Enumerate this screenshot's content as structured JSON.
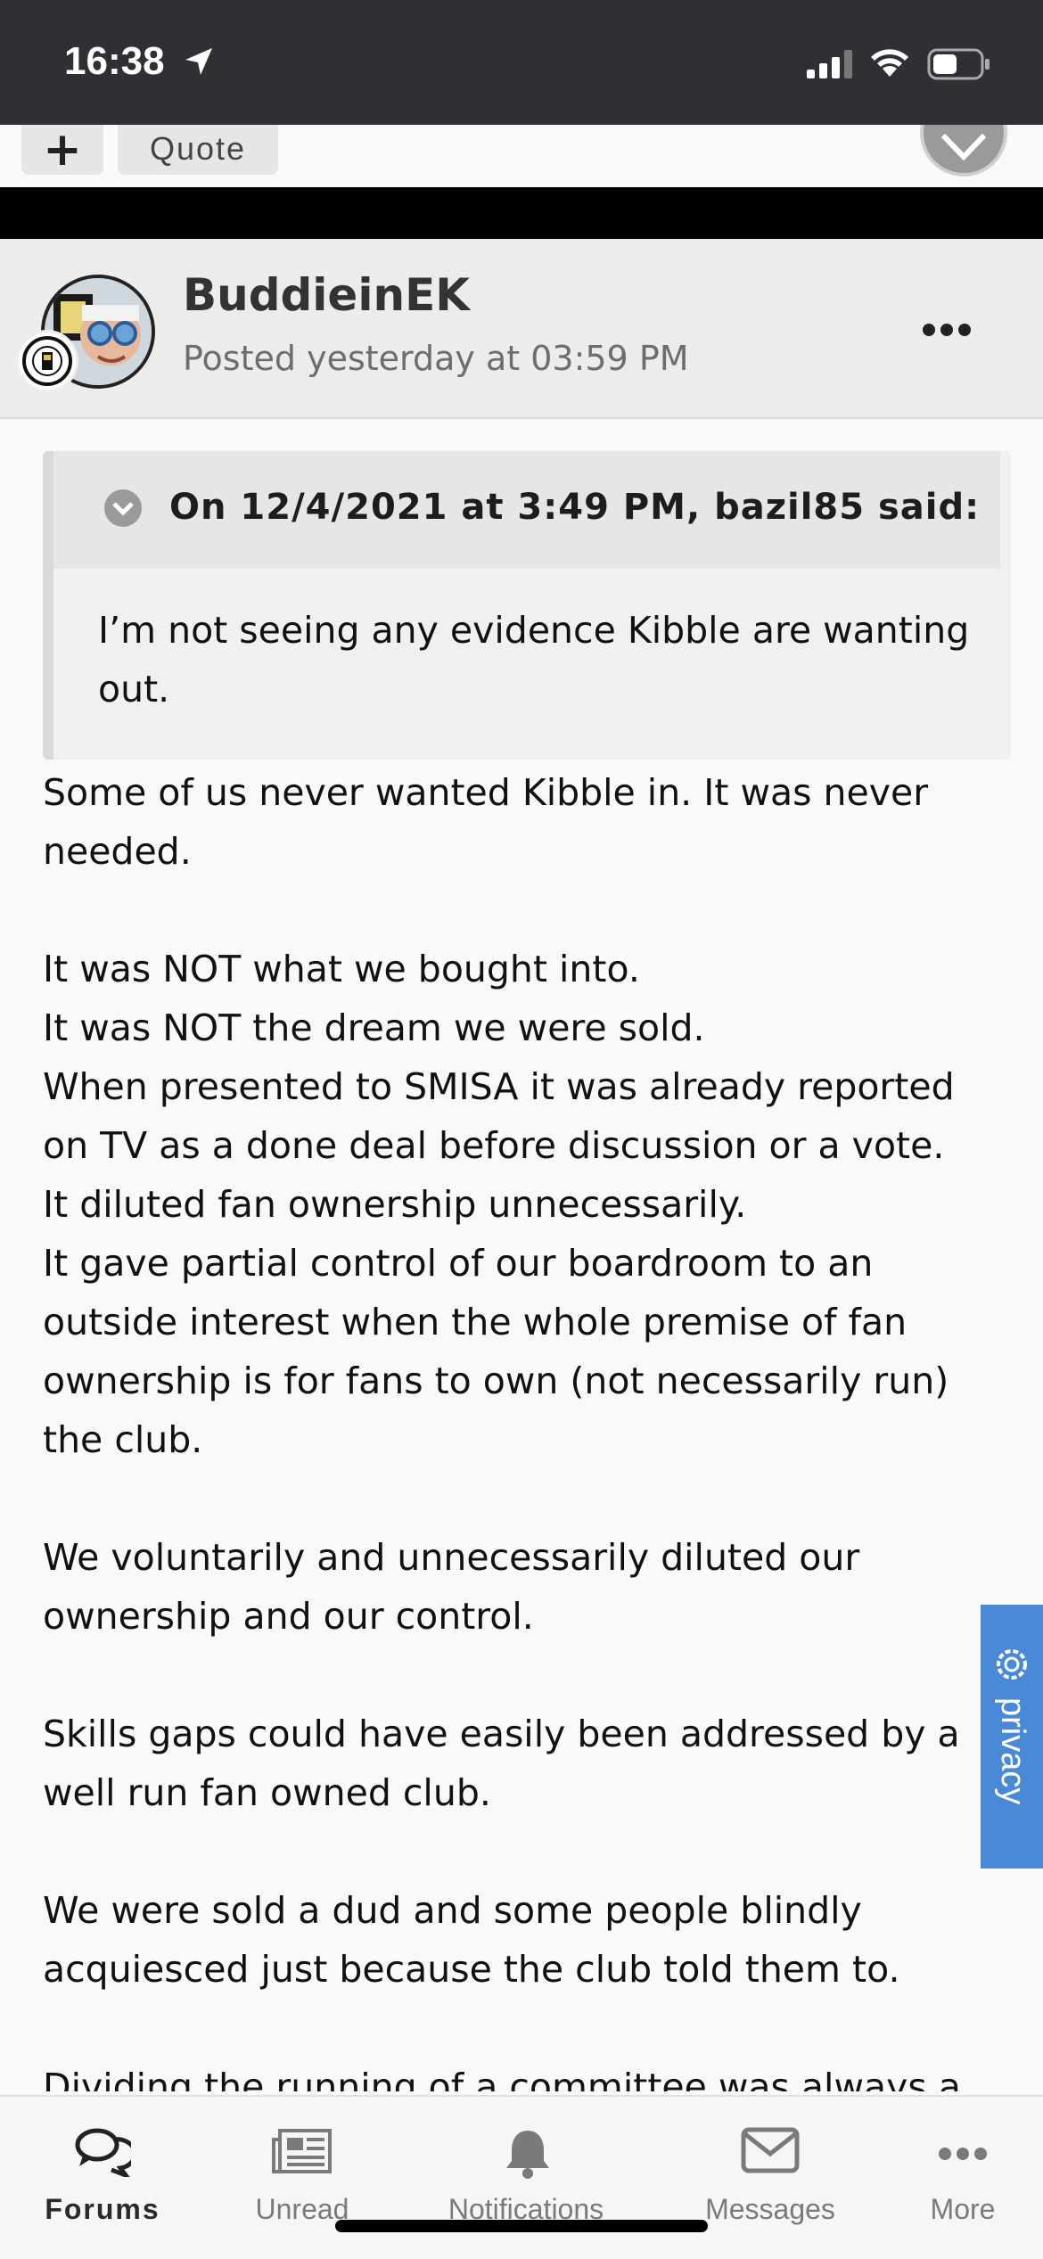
{
  "status_bar": {
    "time": "16:38"
  },
  "previous_post": {
    "plus_label": "+",
    "quote_label": "Quote"
  },
  "post": {
    "author": "BuddieinEK",
    "posted": "Posted yesterday at 03:59 PM",
    "quote": {
      "cite": "On 12/4/2021 at 3:49 PM, bazil85 said:",
      "text": "I’m not seeing any evidence Kibble are wanting out."
    },
    "paragraphs": [
      "Some of us never wanted Kibble in. It was never needed.",
      "It was NOT what we bought into.\nIt was NOT the dream we were sold.\nWhen presented to SMISA it was already reported on TV as a done deal before discussion or a vote.\nIt diluted fan ownership unnecessarily.\nIt gave partial control of our boardroom to an outside interest when the whole premise of fan ownership is for fans to own (not necessarily run) the club.",
      "We voluntarily and unnecessarily diluted our ownership and our control.",
      "Skills gaps could have easily been addressed by a well run fan owned club.",
      "We were sold a dud and some people blindly acquiesced just because the club told them to.",
      "Dividing the running of a committee was always a"
    ]
  },
  "privacy": {
    "label": "privacy"
  },
  "tab_bar": {
    "items": [
      {
        "label": "Forums",
        "icon": "chat-bubbles-icon",
        "active": true
      },
      {
        "label": "Unread",
        "icon": "newspaper-icon",
        "active": false
      },
      {
        "label": "Notifications",
        "icon": "bell-icon",
        "active": false
      },
      {
        "label": "Messages",
        "icon": "envelope-icon",
        "active": false
      },
      {
        "label": "More",
        "icon": "ellipsis-icon",
        "active": false
      }
    ]
  },
  "colors": {
    "status_bar": "#2f3033",
    "privacy_tab": "#4a89d6",
    "header_bg": "#ececec"
  }
}
